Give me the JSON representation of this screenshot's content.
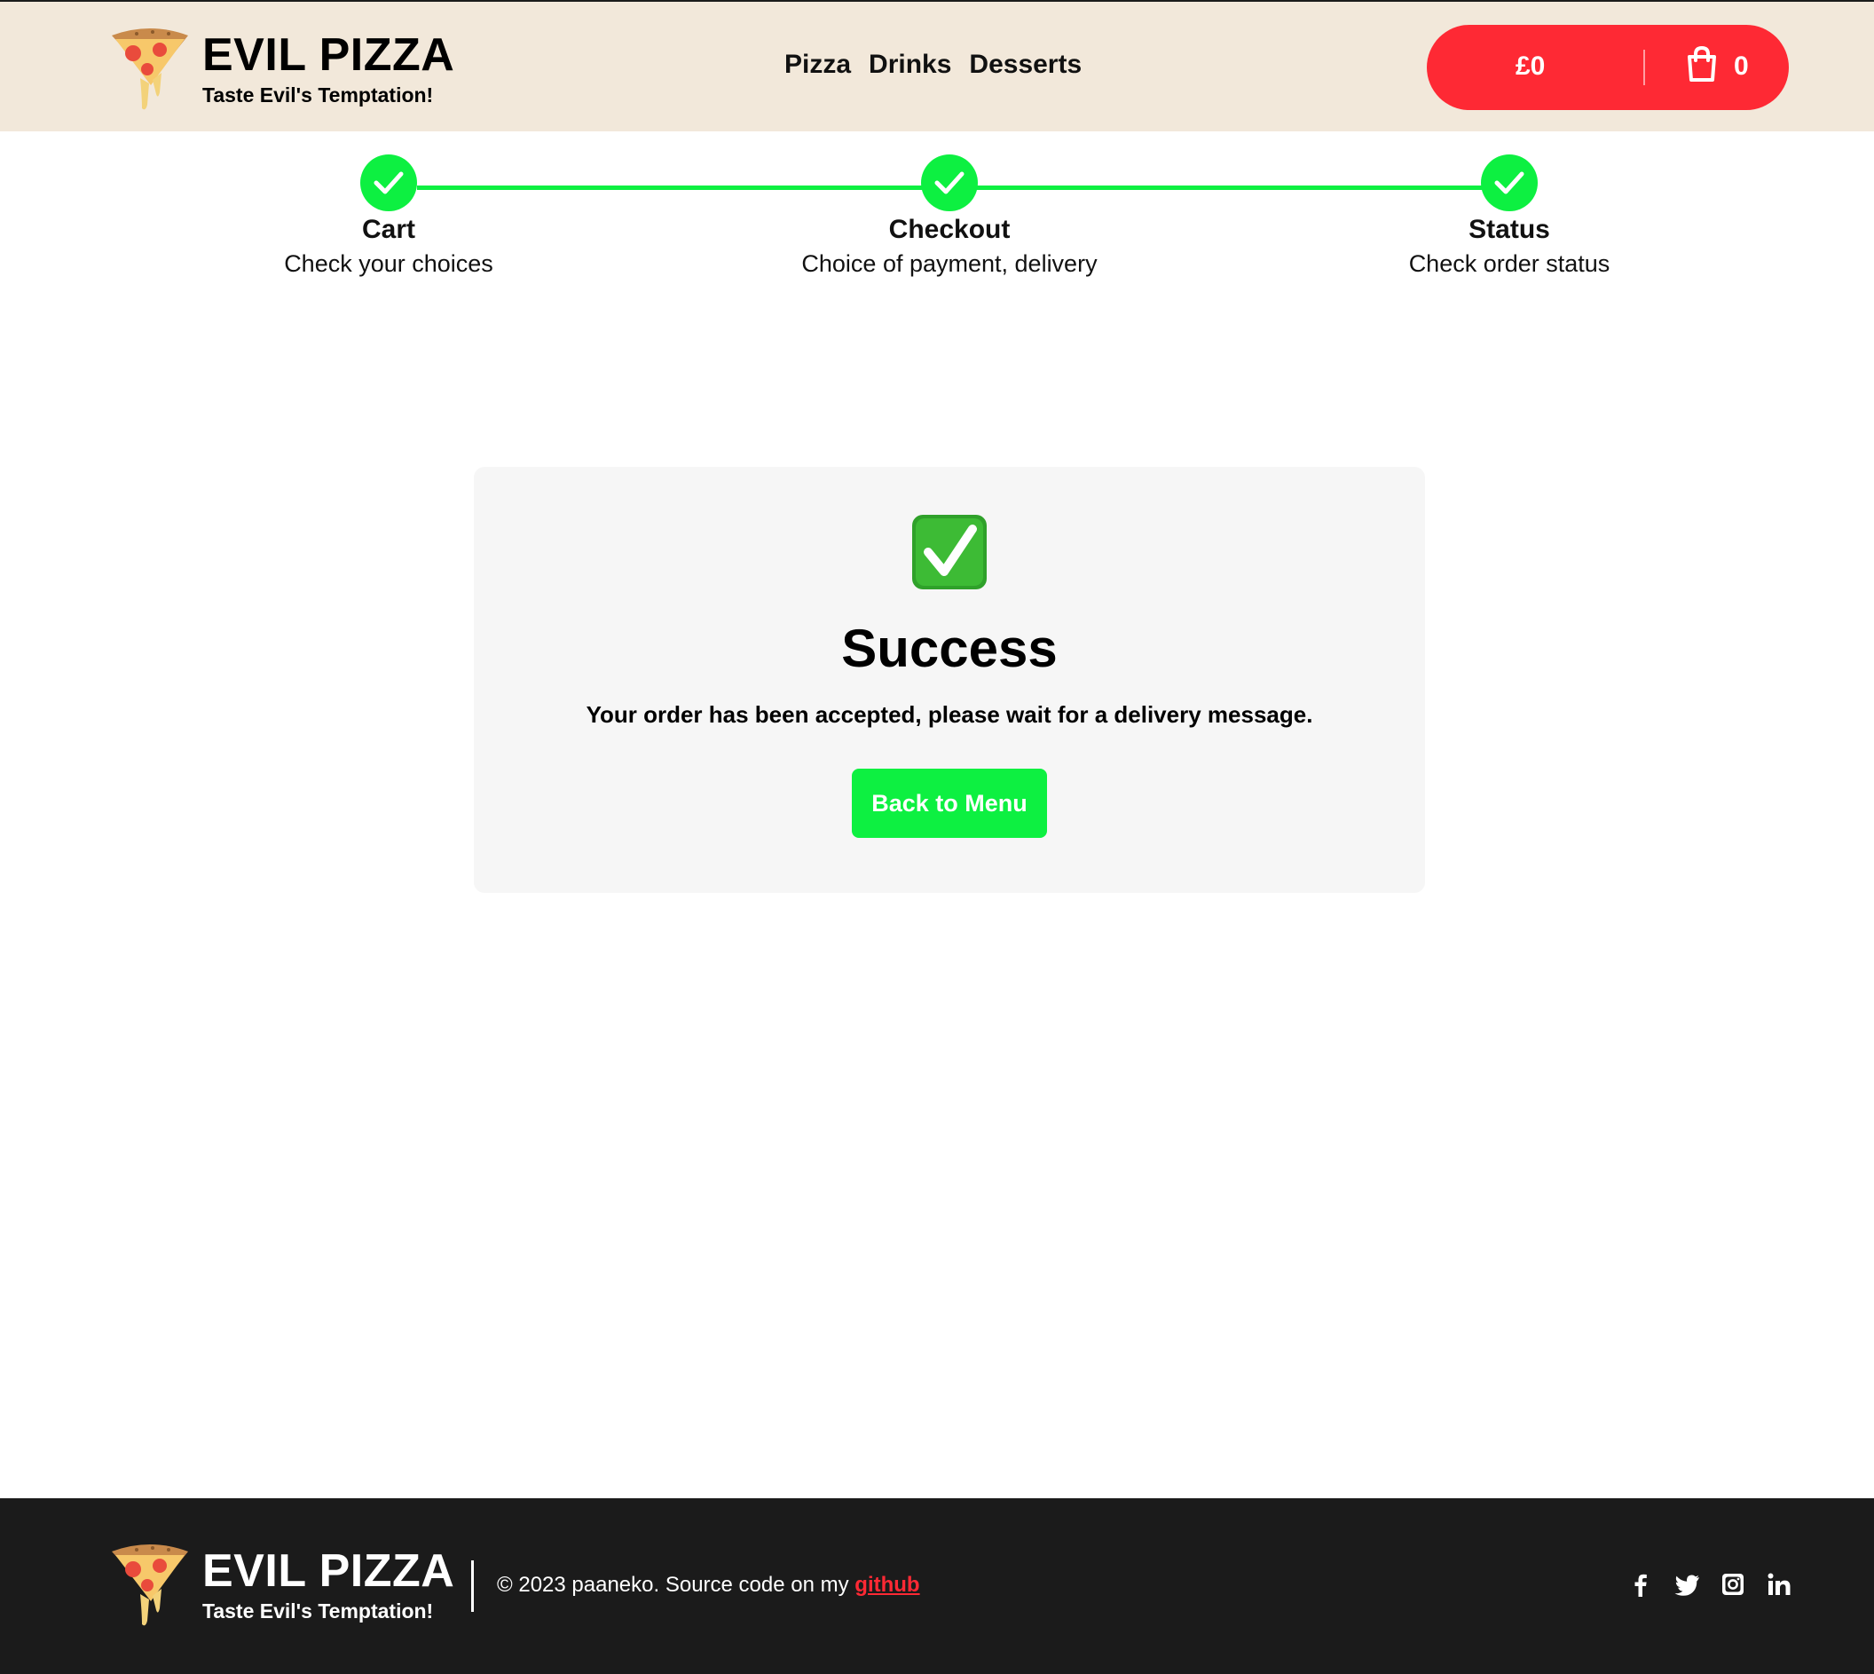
{
  "header": {
    "brand": "EVIL PIZZA",
    "tagline": "Taste Evil's Temptation!",
    "nav": [
      "Pizza",
      "Drinks",
      "Desserts"
    ],
    "cart": {
      "price": "£0",
      "count": "0"
    }
  },
  "stepper": {
    "steps": [
      {
        "title": "Cart",
        "subtitle": "Check your choices"
      },
      {
        "title": "Checkout",
        "subtitle": "Choice of payment, delivery"
      },
      {
        "title": "Status",
        "subtitle": "Check order status"
      }
    ]
  },
  "success": {
    "title": "Success",
    "message": "Your order has been accepted, please wait for a delivery message.",
    "button_label": "Back to Menu"
  },
  "footer": {
    "brand": "EVIL PIZZA",
    "tagline": "Taste Evil's Temptation!",
    "copyright": "© 2023 paaneko. Source code on my",
    "link_text": "github",
    "social": [
      "facebook-icon",
      "twitter-icon",
      "instagram-icon",
      "linkedin-icon"
    ]
  },
  "colors": {
    "header_bg": "#f2e8da",
    "accent_red": "#fe2934",
    "accent_green": "#0df041",
    "footer_bg": "#1b1b1b"
  }
}
